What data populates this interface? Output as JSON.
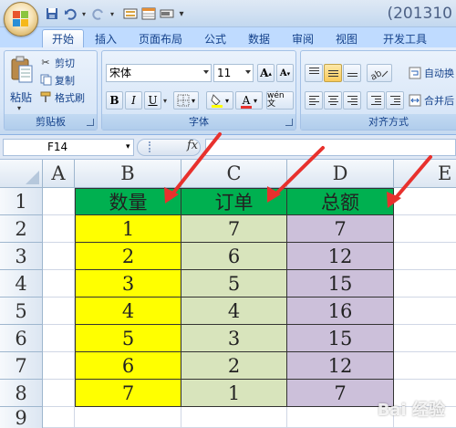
{
  "title": "(201310",
  "tabs": [
    "开始",
    "插入",
    "页面布局",
    "公式",
    "数据",
    "审阅",
    "视图",
    "开发工具"
  ],
  "clipboard": {
    "paste": "粘贴",
    "cut": "剪切",
    "copy": "复制",
    "format_painter": "格式刷",
    "group_label": "剪贴板"
  },
  "font": {
    "name": "宋体",
    "size": "11",
    "bold": "B",
    "italic": "I",
    "underline": "U",
    "font_color_glyph": "A",
    "phonetic": "wén 文",
    "group_label": "字体"
  },
  "alignment": {
    "wrap_text": "自动换",
    "merge_center": "合并后",
    "group_label": "对齐方式"
  },
  "name_box": "F14",
  "fx": "fx",
  "columns": [
    "A",
    "B",
    "C",
    "D",
    "E"
  ],
  "rows": [
    "1",
    "2",
    "3",
    "4",
    "5",
    "6",
    "7",
    "8",
    "9"
  ],
  "table": {
    "headers": [
      "数量",
      "订单",
      "总额"
    ],
    "rows": [
      [
        "1",
        "7",
        "7"
      ],
      [
        "2",
        "6",
        "12"
      ],
      [
        "3",
        "5",
        "15"
      ],
      [
        "4",
        "4",
        "16"
      ],
      [
        "5",
        "3",
        "15"
      ],
      [
        "6",
        "2",
        "12"
      ],
      [
        "7",
        "1",
        "7"
      ]
    ]
  },
  "colors": {
    "header_fill": "#00b050",
    "col_b_fill": "#ffff00",
    "col_c_fill": "#d8e4bc",
    "col_d_fill": "#ccc0da",
    "arrow": "#e8312d"
  },
  "watermark": "Bai 经验"
}
